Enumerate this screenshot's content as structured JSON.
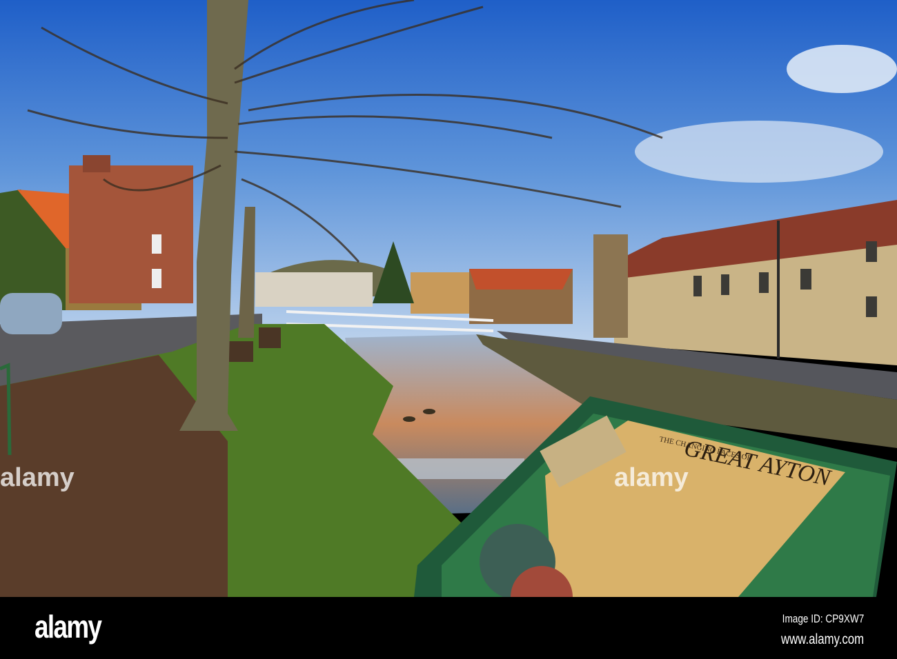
{
  "photo": {
    "sign_subtitle": "THE CHANGING FACES OF",
    "sign_title": "GREAT AYTON",
    "watermark": "alamy"
  },
  "footer": {
    "logo": "alamy",
    "image_id": "Image ID: CP9XW7",
    "website": "www.alamy.com"
  }
}
